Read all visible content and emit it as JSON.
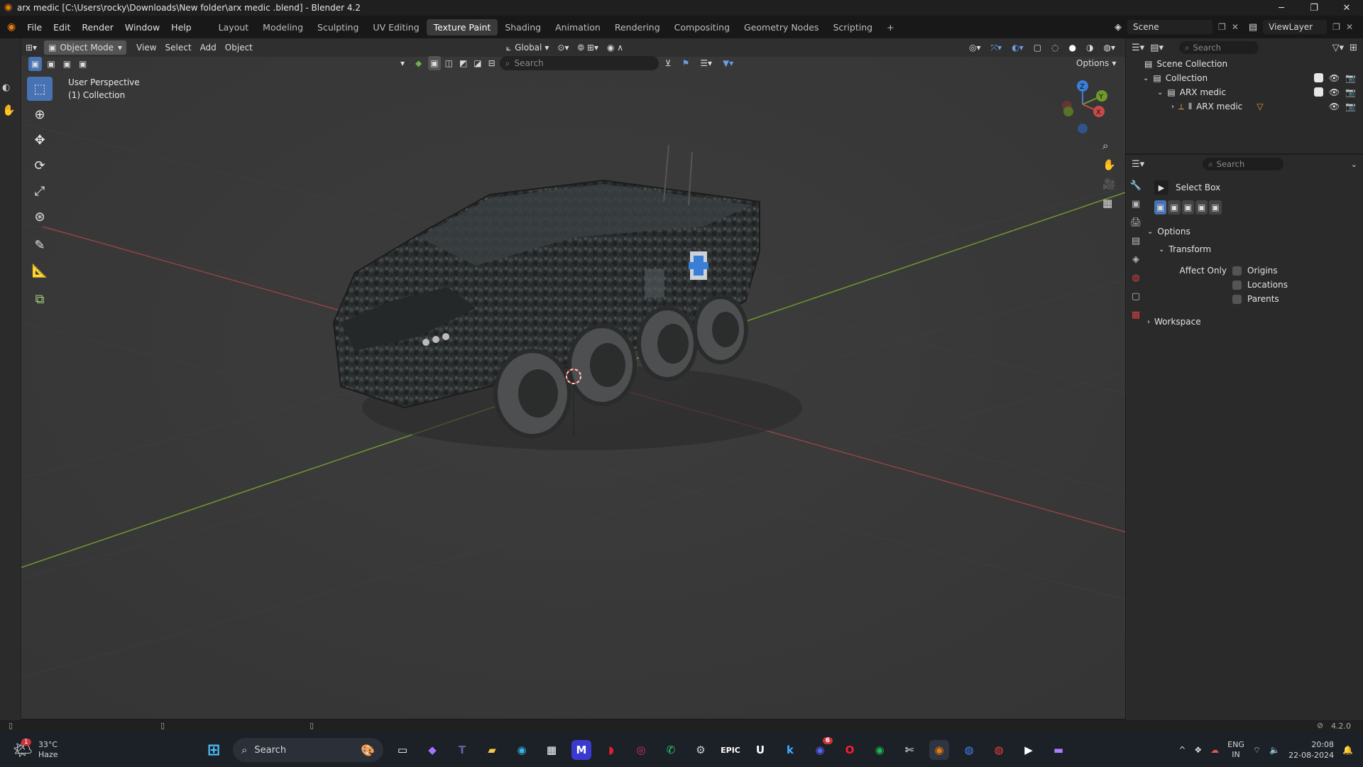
{
  "window": {
    "title": "arx medic  [C:\\Users\\rocky\\Downloads\\New folder\\arx medic .blend] - Blender 4.2",
    "minimize": "─",
    "maximize": "❐",
    "close": "✕"
  },
  "menu": [
    "File",
    "Edit",
    "Render",
    "Window",
    "Help"
  ],
  "workspaces": [
    "Layout",
    "Modeling",
    "Sculpting",
    "UV Editing",
    "Texture Paint",
    "Shading",
    "Animation",
    "Rendering",
    "Compositing",
    "Geometry Nodes",
    "Scripting",
    "+"
  ],
  "active_workspace": "Texture Paint",
  "scene": {
    "label": "Scene",
    "view_layer": "ViewLayer"
  },
  "viewport": {
    "mode": "Object Mode",
    "menus": [
      "View",
      "Select",
      "Add",
      "Object"
    ],
    "orientation": "Global",
    "search_placeholder": "Search",
    "options": "Options",
    "overlay_line1": "User Perspective",
    "overlay_line2": "(1) Collection",
    "gizmo": {
      "x": "X",
      "y": "Y",
      "z": "Z"
    }
  },
  "tools": [
    "select-box",
    "cursor",
    "move",
    "rotate",
    "scale",
    "transform",
    "annotate",
    "measure",
    "add-cube"
  ],
  "outliner": {
    "search_placeholder": "Search",
    "scene_collection": "Scene Collection",
    "collection": "Collection",
    "child": "ARX medic",
    "object": "ARX medic"
  },
  "properties": {
    "search_placeholder": "Search",
    "tool_name": "Select Box",
    "options": "Options",
    "transform": "Transform",
    "affect_only": "Affect Only",
    "origins": "Origins",
    "locations": "Locations",
    "parents": "Parents",
    "workspace": "Workspace"
  },
  "statusbar": {
    "version": "4.2.0"
  },
  "taskbar": {
    "weather_temp": "33°C",
    "weather_desc": "Haze",
    "search_label": "Search",
    "lang_line1": "ENG",
    "lang_line2": "IN",
    "time": "20:08",
    "date": "22-08-2024",
    "notification_badge": "1",
    "discord_badge": "6"
  },
  "colors": {
    "accent": "#4772b3",
    "axis_x": "#c94a4a",
    "axis_y": "#6f9a2b",
    "axis_z": "#3b7ed8"
  }
}
